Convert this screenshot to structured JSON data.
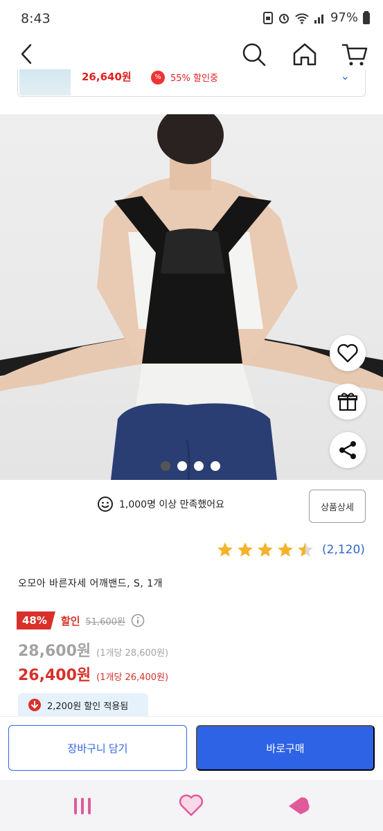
{
  "status": {
    "time": "8:43",
    "battery": "97%"
  },
  "nav": {
    "back": "back",
    "icons": [
      "search-icon",
      "home-icon",
      "cart-icon"
    ]
  },
  "banner": {
    "price": "26,640원",
    "discount": "55% 할인중"
  },
  "carousel": {
    "total": 4,
    "active": 1
  },
  "satisfaction": {
    "text": "1,000명 이상 만족했어요"
  },
  "detail_button": "상품상세",
  "rating": {
    "stars": 4.5,
    "count": "(2,120)"
  },
  "product": {
    "title": "오모아 바른자세 어깨밴드, S, 1개"
  },
  "pricing": {
    "discount_pct": "48%",
    "sale_label": "할인",
    "original_price": "51,600원",
    "price": "28,600원",
    "unit_price": "(1개당 28,600원)",
    "final_price": "26,400원",
    "final_unit_price": "(1개당 26,400원)",
    "coupon": "2,200원 할인 적용됨"
  },
  "actions": {
    "cart": "장바구니 담기",
    "buy": "바로구매"
  },
  "colors": {
    "accent": "#2f63e6",
    "sale": "#d9302a",
    "star": "#f5b22a"
  }
}
